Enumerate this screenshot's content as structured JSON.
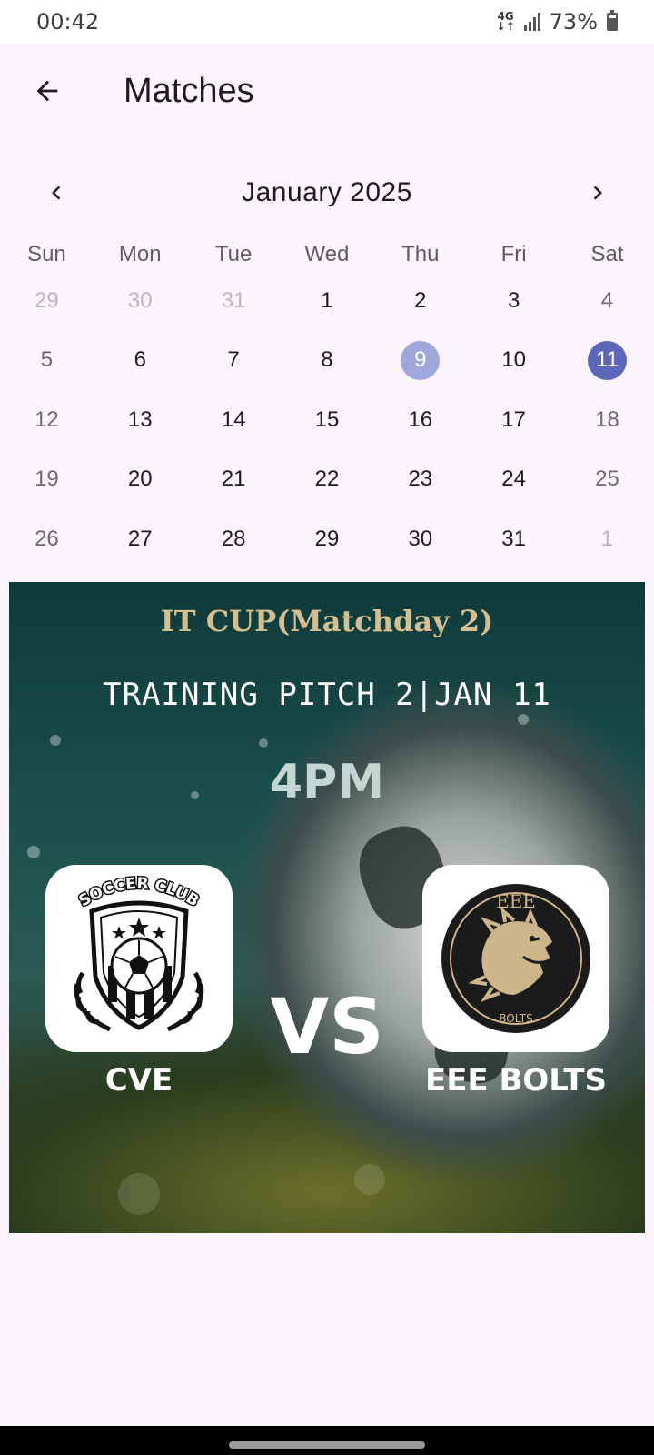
{
  "status_bar": {
    "time": "00:42",
    "network_type_top": "4G",
    "network_type_bottom": "↓↑",
    "battery_text": "73%",
    "battery_level": 0.73
  },
  "app_bar": {
    "back_icon": "arrow-back-icon",
    "title": "Matches"
  },
  "calendar": {
    "month_label": "January 2025",
    "prev_icon": "chevron-left-icon",
    "next_icon": "chevron-right-icon",
    "weekdays": [
      "Sun",
      "Mon",
      "Tue",
      "Wed",
      "Thu",
      "Fri",
      "Sat"
    ],
    "days": [
      {
        "label": "29",
        "outside": true
      },
      {
        "label": "30",
        "outside": true
      },
      {
        "label": "31",
        "outside": true
      },
      {
        "label": "1"
      },
      {
        "label": "2"
      },
      {
        "label": "3"
      },
      {
        "label": "4"
      },
      {
        "label": "5"
      },
      {
        "label": "6"
      },
      {
        "label": "7"
      },
      {
        "label": "8"
      },
      {
        "label": "9",
        "today": true
      },
      {
        "label": "10"
      },
      {
        "label": "11",
        "selected": true
      },
      {
        "label": "12"
      },
      {
        "label": "13"
      },
      {
        "label": "14"
      },
      {
        "label": "15"
      },
      {
        "label": "16"
      },
      {
        "label": "17"
      },
      {
        "label": "18"
      },
      {
        "label": "19"
      },
      {
        "label": "20"
      },
      {
        "label": "21"
      },
      {
        "label": "22"
      },
      {
        "label": "23"
      },
      {
        "label": "24"
      },
      {
        "label": "25"
      },
      {
        "label": "26"
      },
      {
        "label": "27"
      },
      {
        "label": "28"
      },
      {
        "label": "29"
      },
      {
        "label": "30"
      },
      {
        "label": "31"
      },
      {
        "label": "1",
        "outside": true
      }
    ],
    "colors": {
      "today_circle": "#9ea8dc",
      "selected_circle": "#5c68b7"
    }
  },
  "match": {
    "competition": "IT CUP(Matchday 2)",
    "venue_date": "TRAINING PITCH 2|JAN 11",
    "time": "4PM",
    "vs_label": "VS",
    "home_team": {
      "name": "CVE",
      "logo_text": "SOCCER CLUB",
      "logo_icon": "soccer-club-crest-icon"
    },
    "away_team": {
      "name": "EEE BOLTS",
      "logo_text_top": "EEE",
      "logo_text_bottom": "BOLTS",
      "logo_icon": "lion-head-crest-icon"
    },
    "accent_gold": "#d3bf8f"
  }
}
